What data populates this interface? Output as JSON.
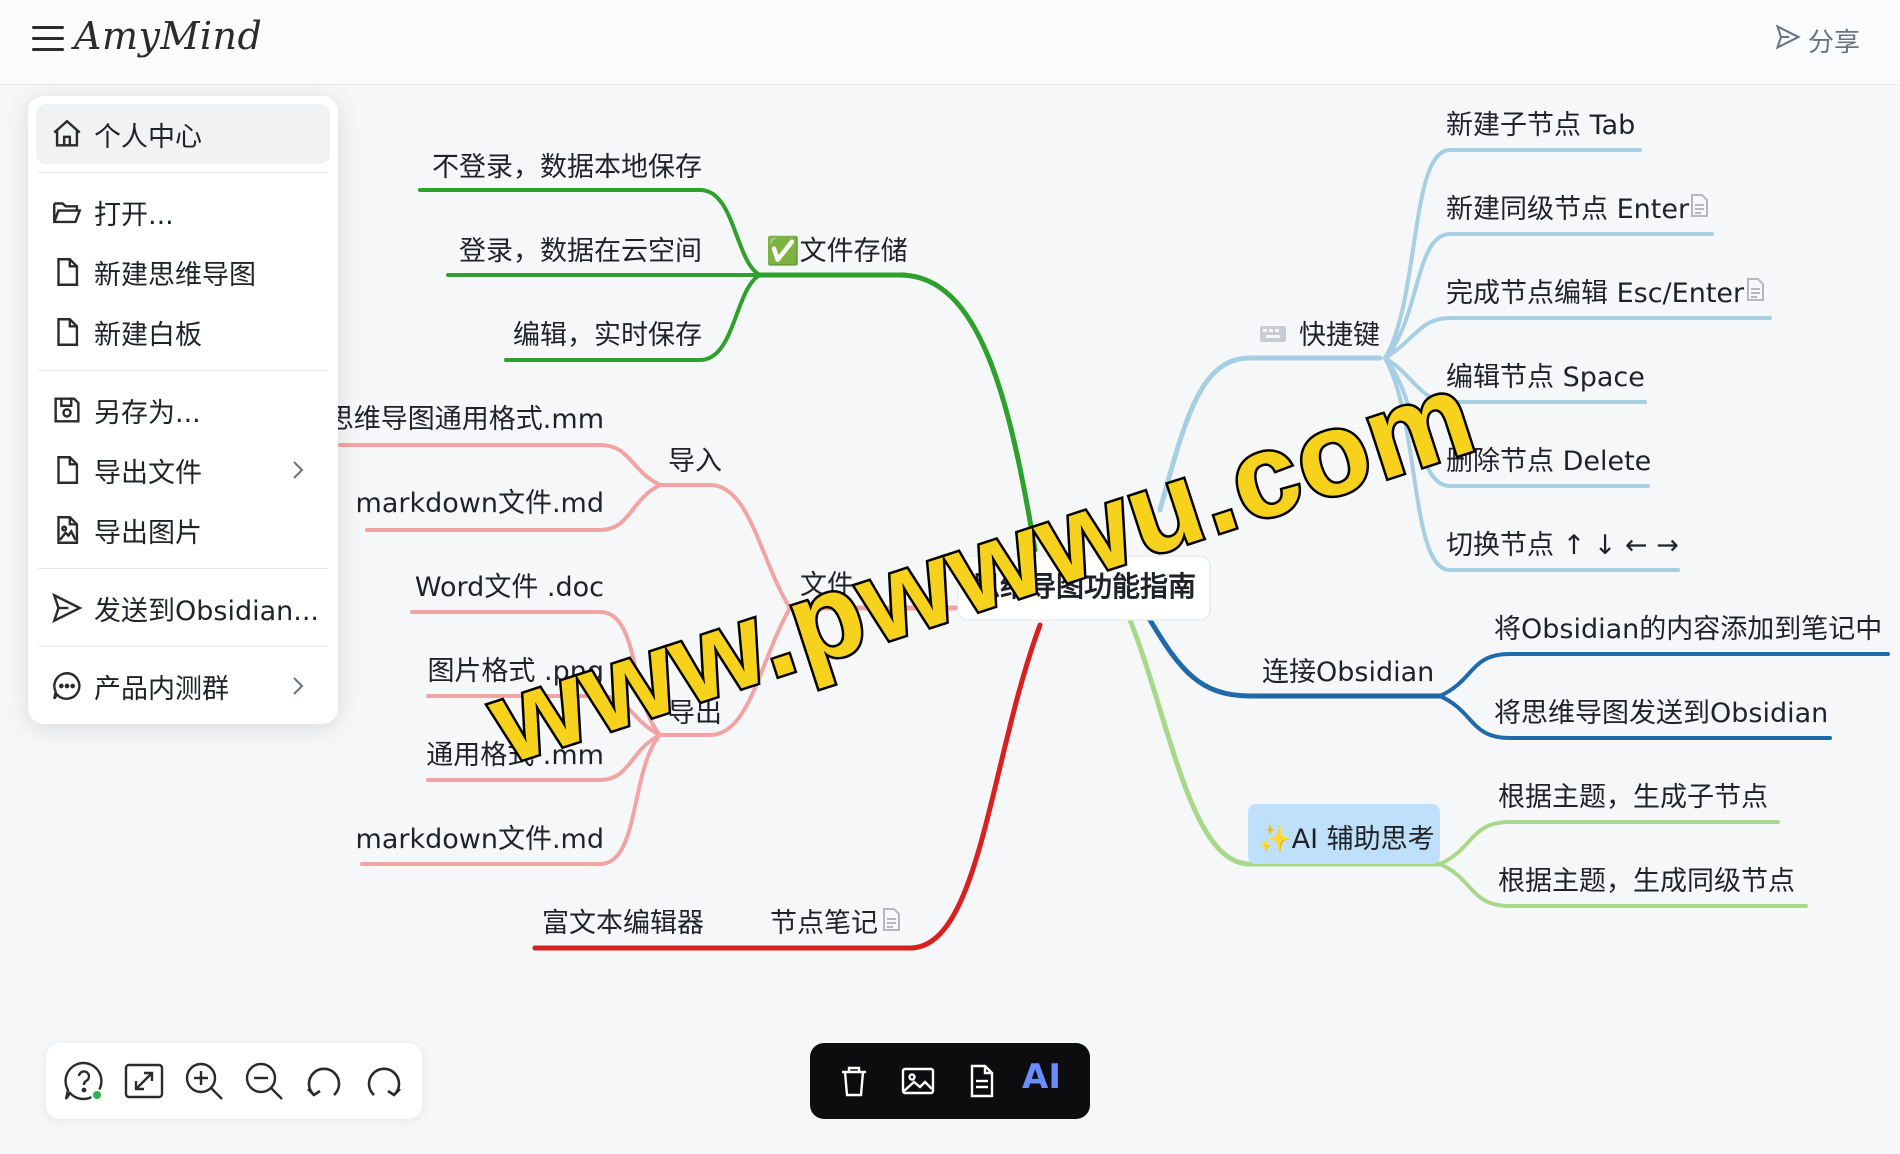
{
  "app": {
    "brand": "AmyMind",
    "share_label": "分享"
  },
  "menu": {
    "items": [
      {
        "label": "个人中心",
        "icon": "home-icon"
      },
      {
        "label": "打开...",
        "icon": "folder-open-icon"
      },
      {
        "label": "新建思维导图",
        "icon": "file-icon"
      },
      {
        "label": "新建白板",
        "icon": "file-icon"
      },
      {
        "label": "另存为...",
        "icon": "save-icon"
      },
      {
        "label": "导出文件",
        "icon": "file-icon"
      },
      {
        "label": "导出图片",
        "icon": "image-file-icon"
      },
      {
        "label": "发送到Obsidian...",
        "icon": "send-icon"
      },
      {
        "label": "产品内测群",
        "icon": "chat-icon"
      }
    ]
  },
  "mindmap": {
    "root": "思维导图功能指南",
    "file_storage": {
      "label": "✅文件存储",
      "children": [
        "不登录，数据本地保存",
        "登录，数据在云空间",
        "编辑，实时保存"
      ]
    },
    "file": {
      "label": "文件",
      "import": {
        "label": "导入",
        "children": [
          "思维导图通用格式.mm",
          "markdown文件.md"
        ]
      },
      "export": {
        "label": "导出",
        "children": [
          "Word文件 .doc",
          "图片格式 .png",
          "通用格式 .mm",
          "markdown文件.md"
        ]
      }
    },
    "node_notes": {
      "label": "节点笔记",
      "children": [
        "富文本编辑器"
      ]
    },
    "shortcuts": {
      "label": "快捷键",
      "children": [
        "新建子节点 Tab",
        "新建同级节点 Enter",
        "完成节点编辑 Esc/Enter",
        "编辑节点 Space",
        "删除节点 Delete",
        "切换节点 ↑ ↓ ← →"
      ]
    },
    "obsidian": {
      "label": "连接Obsidian",
      "children": [
        "将Obsidian的内容添加到笔记中",
        "将思维导图发送到Obsidian"
      ]
    },
    "ai": {
      "label": "✨AI 辅助思考",
      "children": [
        "根据主题，生成子节点",
        "根据主题，生成同级节点"
      ]
    }
  },
  "node_toolbar": {
    "ai_label": "AI"
  },
  "watermark": "www.pwwwu.com",
  "colors": {
    "green": "#2ea02c",
    "pink": "#f2a3a3",
    "red": "#d8201f",
    "lightblue": "#a7cfe3",
    "darkblue": "#1f6aa8",
    "lightgreen": "#a8d98a",
    "ai_highlight": "#bfe0fb"
  }
}
